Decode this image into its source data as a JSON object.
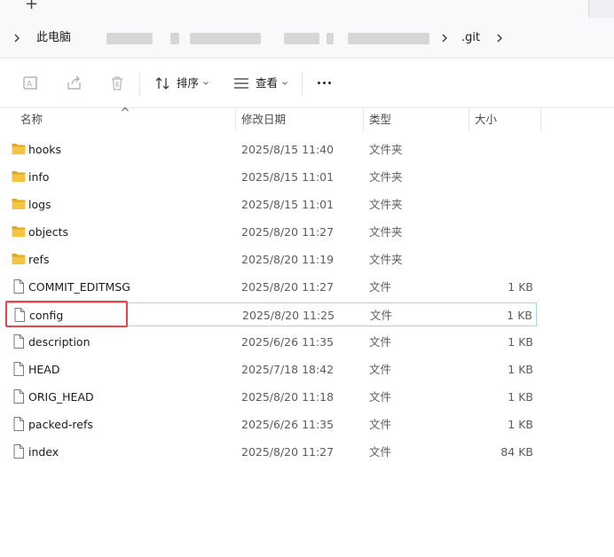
{
  "tabs": {
    "new_tab_glyph": "+"
  },
  "breadcrumb": {
    "items": [
      "此电脑",
      ".git"
    ]
  },
  "toolbar": {
    "sort_label": "排序",
    "view_label": "查看",
    "icons": [
      "rename-icon",
      "share-icon",
      "delete-icon",
      "sort-icon",
      "view-icon",
      "more-icon"
    ]
  },
  "columns": {
    "name": "名称",
    "date": "修改日期",
    "type": "类型",
    "size": "大小"
  },
  "files": [
    {
      "name": "hooks",
      "date": "2025/8/15 11:40",
      "type": "文件夹",
      "size": "",
      "kind": "folder"
    },
    {
      "name": "info",
      "date": "2025/8/15 11:01",
      "type": "文件夹",
      "size": "",
      "kind": "folder"
    },
    {
      "name": "logs",
      "date": "2025/8/15 11:01",
      "type": "文件夹",
      "size": "",
      "kind": "folder"
    },
    {
      "name": "objects",
      "date": "2025/8/20 11:27",
      "type": "文件夹",
      "size": "",
      "kind": "folder"
    },
    {
      "name": "refs",
      "date": "2025/8/20 11:19",
      "type": "文件夹",
      "size": "",
      "kind": "folder"
    },
    {
      "name": "COMMIT_EDITMSG",
      "date": "2025/8/20 11:27",
      "type": "文件",
      "size": "1 KB",
      "kind": "file"
    },
    {
      "name": "config",
      "date": "2025/8/20 11:25",
      "type": "文件",
      "size": "1 KB",
      "kind": "file"
    },
    {
      "name": "description",
      "date": "2025/6/26 11:35",
      "type": "文件",
      "size": "1 KB",
      "kind": "file"
    },
    {
      "name": "HEAD",
      "date": "2025/7/18 18:42",
      "type": "文件",
      "size": "1 KB",
      "kind": "file"
    },
    {
      "name": "ORIG_HEAD",
      "date": "2025/8/20 11:18",
      "type": "文件",
      "size": "1 KB",
      "kind": "file"
    },
    {
      "name": "packed-refs",
      "date": "2025/6/26 11:35",
      "type": "文件",
      "size": "1 KB",
      "kind": "file"
    },
    {
      "name": "index",
      "date": "2025/8/20 11:27",
      "type": "文件",
      "size": "84 KB",
      "kind": "file"
    }
  ],
  "colors": {
    "folder": "#f4c542",
    "folder_dark": "#e0a91f",
    "selection_border": "#9fd8e0",
    "highlight": "#e8424a"
  }
}
